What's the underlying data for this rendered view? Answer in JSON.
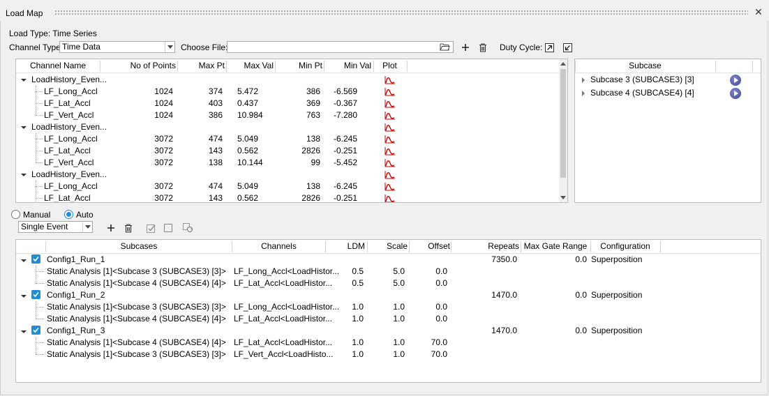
{
  "window": {
    "title": "Load Map",
    "close_glyph": "✕"
  },
  "load_type": "Load Type: Time Series",
  "channel_type": {
    "label": "Channel Type:",
    "value": "Time Data"
  },
  "choose_file": {
    "label": "Choose File:",
    "value": ""
  },
  "duty_cycle": {
    "label": "Duty Cycle:"
  },
  "channels": {
    "headers": [
      "Channel Name",
      "No of Points",
      "Max Pt",
      "Max Val",
      "Min Pt",
      "Min Val",
      "Plot"
    ],
    "groups": [
      {
        "name": "LoadHistory_Even...",
        "rows": [
          {
            "name": "LF_Long_Accl",
            "points": "1024",
            "max_pt": "374",
            "max_val": "5.472",
            "min_pt": "386",
            "min_val": "-6.569"
          },
          {
            "name": "LF_Lat_Accl",
            "points": "1024",
            "max_pt": "403",
            "max_val": "0.437",
            "min_pt": "369",
            "min_val": "-0.367"
          },
          {
            "name": "LF_Vert_Accl",
            "points": "1024",
            "max_pt": "386",
            "max_val": "10.984",
            "min_pt": "763",
            "min_val": "-7.280"
          }
        ]
      },
      {
        "name": "LoadHistory_Even...",
        "rows": [
          {
            "name": "LF_Long_Accl",
            "points": "3072",
            "max_pt": "474",
            "max_val": "5.049",
            "min_pt": "138",
            "min_val": "-6.245"
          },
          {
            "name": "LF_Lat_Accl",
            "points": "3072",
            "max_pt": "143",
            "max_val": "0.562",
            "min_pt": "2826",
            "min_val": "-0.251"
          },
          {
            "name": "LF_Vert_Accl",
            "points": "3072",
            "max_pt": "138",
            "max_val": "10.144",
            "min_pt": "99",
            "min_val": "-5.452"
          }
        ]
      },
      {
        "name": "LoadHistory_Even...",
        "rows": [
          {
            "name": "LF_Long_Accl",
            "points": "3072",
            "max_pt": "474",
            "max_val": "5.049",
            "min_pt": "138",
            "min_val": "-6.245"
          },
          {
            "name": "LF_Lat_Accl",
            "points": "3072",
            "max_pt": "143",
            "max_val": "0.562",
            "min_pt": "2826",
            "min_val": "-0.251"
          }
        ]
      }
    ]
  },
  "subcase_panel": {
    "header": "Subcase",
    "items": [
      "Subcase 3 (SUBCASE3) [3]",
      "Subcase 4 (SUBCASE4) [4]"
    ]
  },
  "mode": {
    "manual": "Manual",
    "auto": "Auto",
    "selected": "Auto"
  },
  "event_type": {
    "value": "Single Event"
  },
  "runs": {
    "headers": [
      "Subcases",
      "Channels",
      "LDM",
      "Scale",
      "Offset",
      "Repeats",
      "Max Gate Range",
      "Configuration"
    ],
    "configs": [
      {
        "name": "Config1_Run_1",
        "repeats": "7350.0",
        "gate": "0.0",
        "configuration": "Superposition",
        "rows": [
          {
            "subcase": "Static Analysis [1]<Subcase 3 (SUBCASE3) [3]>",
            "channel": "LF_Long_Accl<LoadHistor...",
            "ldm": "0.5",
            "scale": "5.0",
            "offset": "0.0"
          },
          {
            "subcase": "Static Analysis [1]<Subcase 4 (SUBCASE4) [4]>",
            "channel": "LF_Lat_Accl<LoadHistor...",
            "ldm": "0.5",
            "scale": "5.0",
            "offset": "0.0"
          }
        ]
      },
      {
        "name": "Config1_Run_2",
        "repeats": "1470.0",
        "gate": "0.0",
        "configuration": "Superposition",
        "rows": [
          {
            "subcase": "Static Analysis [1]<Subcase 3 (SUBCASE3) [3]>",
            "channel": "LF_Long_Accl<LoadHistor...",
            "ldm": "1.0",
            "scale": "1.0",
            "offset": "0.0"
          },
          {
            "subcase": "Static Analysis [1]<Subcase 4 (SUBCASE4) [4]>",
            "channel": "LF_Lat_Accl<LoadHistor...",
            "ldm": "1.0",
            "scale": "1.0",
            "offset": "0.0"
          }
        ]
      },
      {
        "name": "Config1_Run_3",
        "repeats": "1470.0",
        "gate": "0.0",
        "configuration": "Superposition",
        "rows": [
          {
            "subcase": "Static Analysis [1]<Subcase 4 (SUBCASE4) [4]>",
            "channel": "LF_Lat_Accl<LoadHistor...",
            "ldm": "1.0",
            "scale": "1.0",
            "offset": "70.0"
          },
          {
            "subcase": "Static Analysis [1]<Subcase 3 (SUBCASE3) [3]>",
            "channel": "LF_Vert_Accl<LoadHisto...",
            "ldm": "1.0",
            "scale": "1.0",
            "offset": "70.0"
          }
        ]
      }
    ]
  },
  "colors": {
    "accent": "#1e8ed6",
    "plot_icon": "#cc0000",
    "play": "#4a55a8"
  },
  "icons": [
    "folder-icon",
    "plus-icon",
    "trash-icon",
    "export-icon",
    "import-icon",
    "plot-icon",
    "play-icon",
    "checkbox-icon",
    "refresh-icon"
  ]
}
